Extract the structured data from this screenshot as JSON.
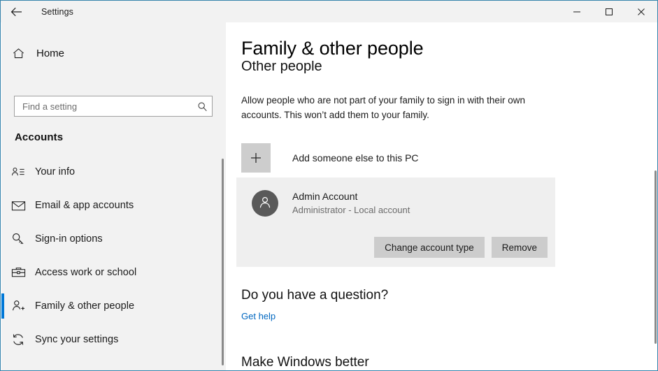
{
  "window": {
    "app_title": "Settings",
    "back_icon": "back-arrow-icon",
    "controls": {
      "minimize": "minimize-icon",
      "maximize": "maximize-icon",
      "close": "close-icon"
    },
    "border_color": "#3583ac"
  },
  "sidebar": {
    "home_label": "Home",
    "home_icon": "home-icon",
    "search": {
      "placeholder": "Find a setting",
      "value": "",
      "icon": "search-icon"
    },
    "section_title": "Accounts",
    "accent_color": "#0078d7",
    "items": [
      {
        "label": "Your info",
        "icon": "person-card-icon",
        "selected": false
      },
      {
        "label": "Email & app accounts",
        "icon": "envelope-icon",
        "selected": false
      },
      {
        "label": "Sign-in options",
        "icon": "key-icon",
        "selected": false
      },
      {
        "label": "Access work or school",
        "icon": "briefcase-icon",
        "selected": false
      },
      {
        "label": "Family & other people",
        "icon": "person-add-icon",
        "selected": true
      },
      {
        "label": "Sync your settings",
        "icon": "sync-icon",
        "selected": false
      }
    ]
  },
  "main": {
    "page_title": "Family & other people",
    "sub_title": "Other people",
    "body_text": "Allow people who are not part of your family to sign in with their own accounts. This won’t add them to your family.",
    "add_person": {
      "label": "Add someone else to this PC",
      "icon": "plus-icon"
    },
    "account": {
      "avatar_icon": "person-icon",
      "name": "Admin Account",
      "detail": "Administrator - Local account",
      "buttons": {
        "change_type": "Change account type",
        "remove": "Remove"
      }
    },
    "question_title": "Do you have a question?",
    "help_link": "Get help",
    "help_link_color": "#0067c0",
    "footer_title": "Make Windows better"
  }
}
